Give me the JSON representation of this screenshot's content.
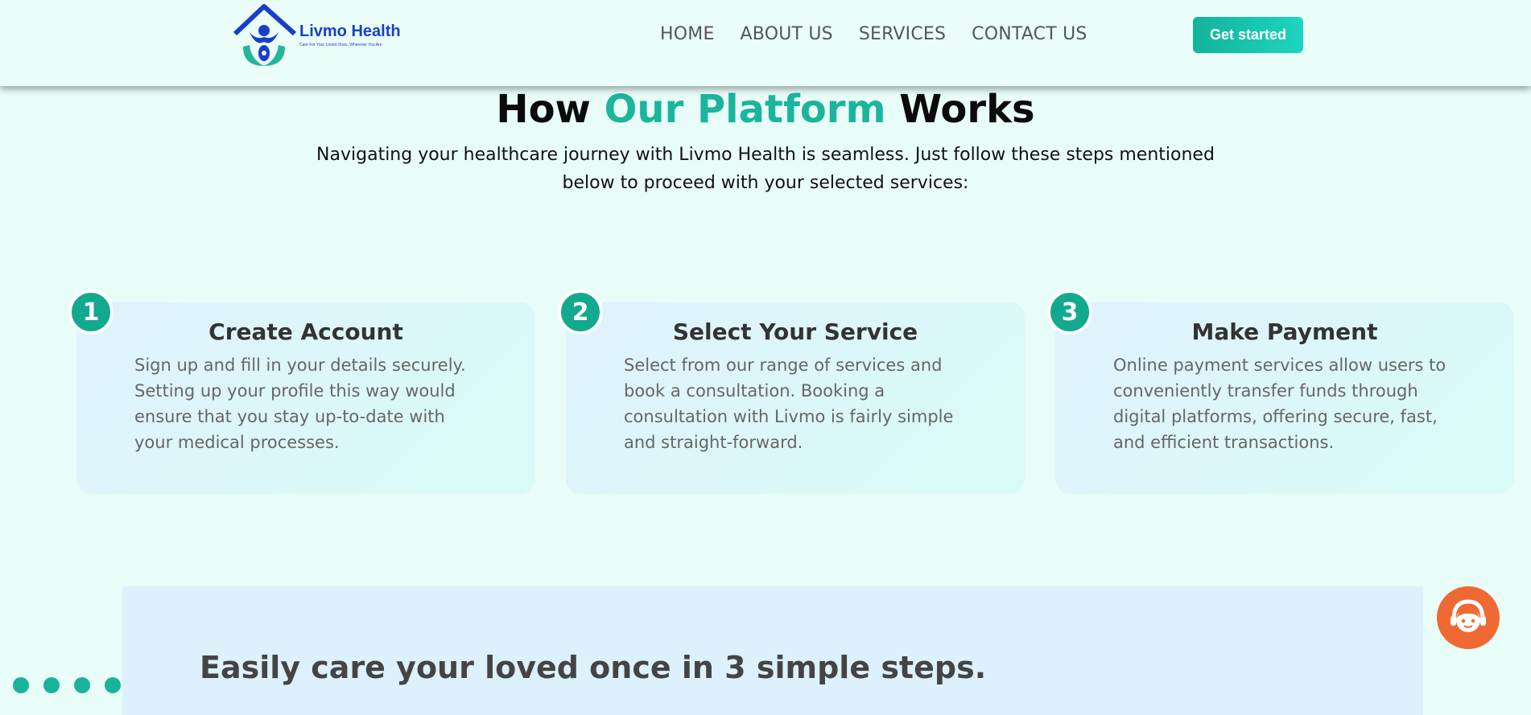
{
  "header": {
    "brand_name": "Livmo Health",
    "brand_tagline": "Care For Your Loved Ones, Wherever You Are",
    "nav": [
      {
        "label": "HOME"
      },
      {
        "label": "ABOUT US"
      },
      {
        "label": "SERVICES"
      },
      {
        "label": "CONTACT US"
      }
    ],
    "cta_label": "Get started"
  },
  "hero": {
    "title_part1": "How ",
    "title_accent": "Our Platform",
    "title_part2": " Works",
    "subtitle": "Navigating your healthcare journey with Livmo Health is seamless. Just follow these steps mentioned below to proceed with your selected services:"
  },
  "steps": [
    {
      "number": "1",
      "title": "Create Account",
      "text": "Sign up and fill in your details securely. Setting up your profile this way would ensure that you stay up-to-date with your medical processes."
    },
    {
      "number": "2",
      "title": "Select Your Service",
      "text": "Select from our range of services and book a consultation. Booking a consultation with Livmo is fairly simple and straight-forward."
    },
    {
      "number": "3",
      "title": "Make Payment",
      "text": "Online payment services allow users to conveniently transfer funds through digital platforms, offering secure, fast, and efficient transactions."
    }
  ],
  "bottom": {
    "title": "Easily care your loved once in 3 simple steps."
  },
  "colors": {
    "accent": "#1ab59c",
    "brand_blue": "#1a3ec8",
    "chat_orange": "#ef6a33"
  },
  "icons": {
    "chat": "support-agent-icon",
    "logo": "house-caregiver-logo"
  }
}
